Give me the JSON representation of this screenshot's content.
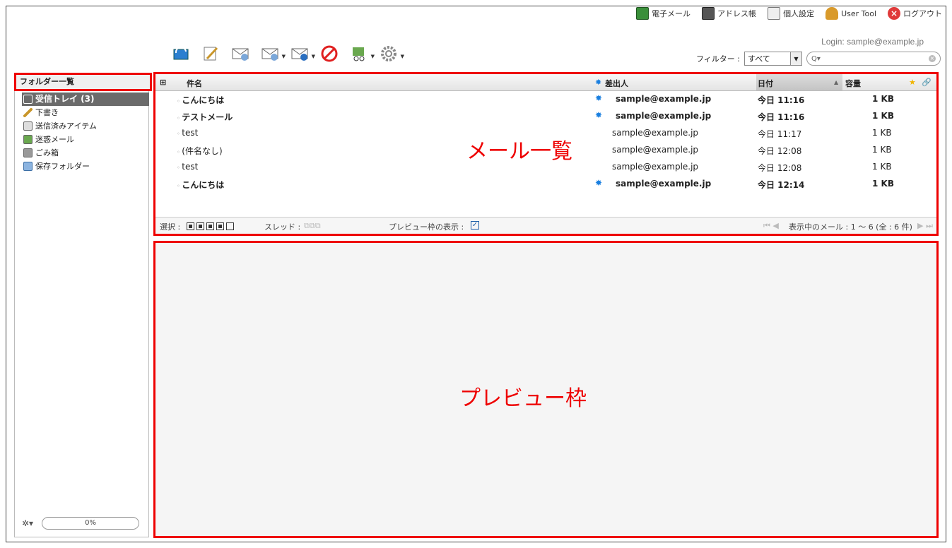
{
  "topnav": {
    "email": "電子メール",
    "address_book": "アドレス帳",
    "settings": "個人設定",
    "user_tool": "User Tool",
    "logout": "ログアウト"
  },
  "login": "Login: sample@example.jp",
  "filter": {
    "label": "フィルター :",
    "value": "すべて",
    "search_placeholder": "Q▾"
  },
  "toolbar": {
    "icons": [
      "check-mail",
      "compose",
      "reply",
      "reply-all",
      "forward",
      "delete",
      "spam",
      "settings"
    ]
  },
  "sidebar": {
    "title": "フォルダー一覧",
    "items": [
      {
        "label": "受信トレイ (3)",
        "icon": "inbox-icon"
      },
      {
        "label": "下書き",
        "icon": "pencil-icon"
      },
      {
        "label": "送信済みアイテム",
        "icon": "sent-icon"
      },
      {
        "label": "迷惑メール",
        "icon": "spam-icon"
      },
      {
        "label": "ごみ箱",
        "icon": "trash-icon"
      },
      {
        "label": "保存フォルダー",
        "icon": "folder-icon"
      }
    ],
    "quota": "0%"
  },
  "maillist": {
    "columns": {
      "subject": "件名",
      "from": "差出人",
      "date": "日付",
      "size": "容量"
    },
    "rows": [
      {
        "subject": "こんにちは",
        "from": "sample@example.jp",
        "date": "今日 11:16",
        "size": "1 KB",
        "unread": true
      },
      {
        "subject": "テストメール",
        "from": "sample@example.jp",
        "date": "今日 11:16",
        "size": "1 KB",
        "unread": true
      },
      {
        "subject": "test",
        "from": "sample@example.jp",
        "date": "今日 11:17",
        "size": "1 KB",
        "unread": false
      },
      {
        "subject": "(件名なし)",
        "from": "sample@example.jp",
        "date": "今日 12:08",
        "size": "1 KB",
        "unread": false
      },
      {
        "subject": "test",
        "from": "sample@example.jp",
        "date": "今日 12:08",
        "size": "1 KB",
        "unread": false
      },
      {
        "subject": "こんにちは",
        "from": "sample@example.jp",
        "date": "今日 12:14",
        "size": "1 KB",
        "unread": true
      }
    ],
    "footer": {
      "select_label": "選択 :",
      "thread_label": "スレッド :",
      "preview_label": "プレビュー枠の表示 :",
      "count": "表示中のメール : 1 〜 6 (全 : 6 件)"
    },
    "overlay_label": "メール一覧"
  },
  "preview": {
    "overlay_label": "プレビュー枠"
  }
}
